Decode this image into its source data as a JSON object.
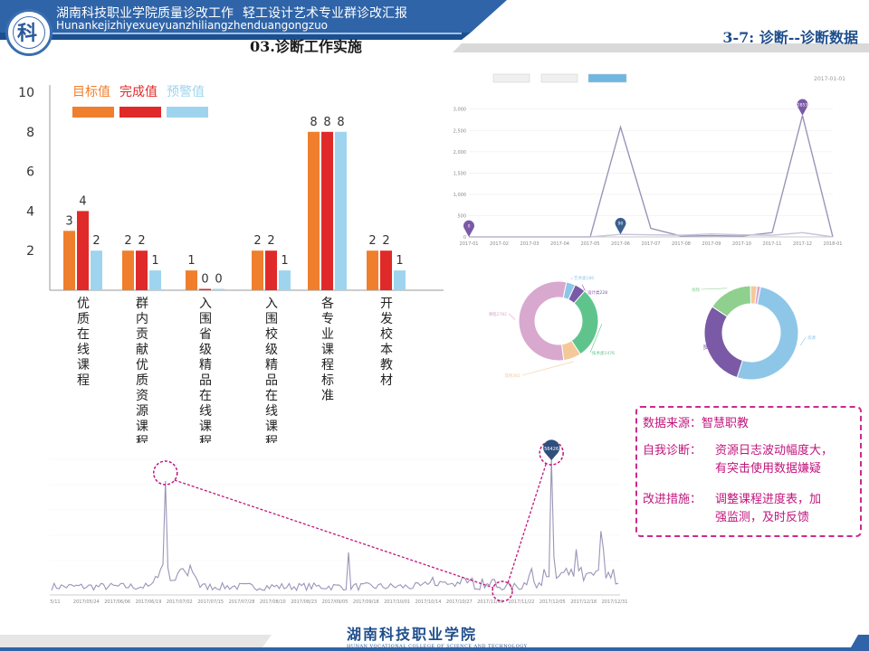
{
  "header": {
    "title_cn": "湖南科技职业学院质量诊改工作",
    "title_sub": "轻工设计艺术专业群诊改汇报",
    "title_pinyin": "Hunankejizhiyexueyuanzhiliangzhenduangongzuo",
    "section": "03.诊断工作实施",
    "slide_title": "3-7: 诊断--诊断数据"
  },
  "colors": {
    "target": "#ef7f2d",
    "actual": "#e02a2a",
    "warning": "#9fd4ef",
    "header_blue": "#2f64a8",
    "accent_magenta": "#c0157c",
    "line_purple": "#9b94b8"
  },
  "chart_data": [
    {
      "type": "bar",
      "legend": [
        "目标值",
        "完成值",
        "预警值"
      ],
      "ylim": [
        0,
        10
      ],
      "yticks": [
        2,
        4,
        6,
        8,
        10
      ],
      "categories": [
        "优质在线课程",
        "群内贡献优质资源课程",
        "入围省级精品在线课程",
        "入围校级精品在线课程",
        "各专业课程标准",
        "开发校本教材"
      ],
      "series": [
        {
          "name": "目标值",
          "values": [
            3,
            2,
            1,
            2,
            8,
            2
          ]
        },
        {
          "name": "完成值",
          "values": [
            4,
            2,
            0,
            2,
            8,
            2
          ]
        },
        {
          "name": "预警值",
          "values": [
            2,
            1,
            0,
            1,
            8,
            1
          ]
        }
      ]
    },
    {
      "type": "line",
      "legend": [
        "",
        "",
        ""
      ],
      "date_label": "2017-01-01",
      "x": [
        "2017-01",
        "2017-02",
        "2017-03",
        "2017-04",
        "2017-05",
        "2017-06",
        "2017-07",
        "2017-08",
        "2017-09",
        "2017-10",
        "2017-11",
        "2017-12",
        "2018-01"
      ],
      "yticks": [
        0,
        500,
        1000,
        1500,
        2000,
        2500,
        3000
      ],
      "ytick_labels": [
        "0",
        "500",
        "1,000",
        "1,500",
        "2,000",
        "2,500",
        "3,000"
      ],
      "ylim": [
        0,
        3100
      ],
      "series": [
        {
          "values": [
            0,
            0,
            0,
            0,
            0,
            2580,
            200,
            20,
            30,
            20,
            100,
            2850,
            0
          ]
        },
        {
          "values": [
            0,
            0,
            0,
            0,
            0,
            60,
            50,
            40,
            70,
            50,
            40,
            100,
            0
          ]
        }
      ],
      "markers": [
        {
          "x": "2017-01",
          "label": "0"
        },
        {
          "x": "2017-06",
          "label": "90"
        },
        {
          "x": "2017-12",
          "label": "2853"
        }
      ]
    },
    {
      "type": "pie",
      "slices": [
        {
          "label": "艺术类186",
          "value": 186,
          "color": "#8ec6e8"
        },
        {
          "label": "设计类228",
          "value": 228,
          "color": "#7a5aa6"
        },
        {
          "label": "技术类1476",
          "value": 1476,
          "color": "#5fc48c"
        },
        {
          "label": "其他361",
          "value": 361,
          "color": "#f5c89a"
        },
        {
          "label": "课程2782",
          "value": 2782,
          "color": "#d8a8cf"
        }
      ]
    },
    {
      "type": "pie",
      "slices": [
        {
          "label": "资源",
          "value": 2560,
          "color": "#8ec6e8"
        },
        {
          "label": "网络",
          "value": 1460,
          "color": "#7a5aa6"
        },
        {
          "label": "视频",
          "value": 760,
          "color": "#8fd08f"
        },
        {
          "label": "",
          "value": 110,
          "color": "#f5c89a"
        },
        {
          "label": "",
          "value": 60,
          "color": "#d8a8cf"
        }
      ]
    },
    {
      "type": "line",
      "x_labels": [
        "5/11",
        "2017/05/24",
        "2017/06/06",
        "2017/06/19",
        "2017/07/02",
        "2017/07/15",
        "2017/07/28",
        "2017/08/10",
        "2017/08/23",
        "2017/09/05",
        "2017/09/18",
        "2017/10/01",
        "2017/10/14",
        "2017/10/27",
        "2017/11/09",
        "2017/11/22",
        "2017/12/05",
        "2017/12/18",
        "2017/12/31"
      ],
      "marker_label": "56426",
      "ylim": [
        0,
        60000
      ]
    }
  ],
  "notes": {
    "source": "数据来源：智慧职教",
    "diagnosis_label": "自我诊断：",
    "diagnosis_l1": "资源日志波动幅度大，",
    "diagnosis_l2": "有突击使用数据嫌疑",
    "improve_label": "改进措施：",
    "improve_l1": "调整课程进度表，加",
    "improve_l2": "强监测，及时反馈"
  },
  "footer": {
    "school": "湖南科技职业学院",
    "school_en": "HUNAN VOCATIONAL COLLEGE OF SCIENCE AND TECHNOLOGY"
  }
}
